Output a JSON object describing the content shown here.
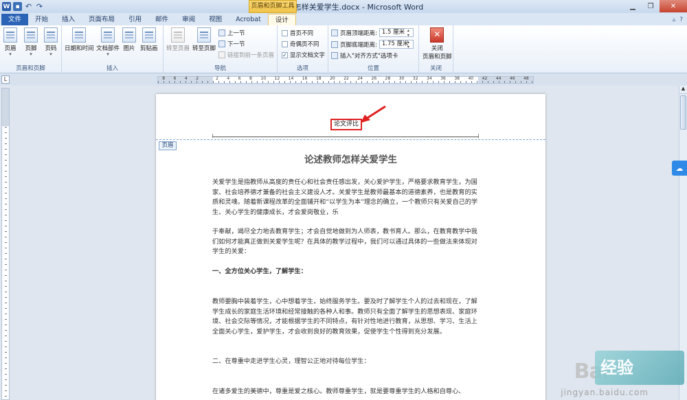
{
  "window": {
    "title": "论述教师怎样关爱学生.docx - Microsoft Word",
    "context_tool": "页眉和页脚工具"
  },
  "tabs": [
    "文件",
    "开始",
    "插入",
    "页面布局",
    "引用",
    "邮件",
    "审阅",
    "视图",
    "Acrobat",
    "设计"
  ],
  "ribbon": {
    "group_header_footer": {
      "label": "页眉和页脚",
      "header": "页眉",
      "footer": "页脚",
      "page_number": "页码"
    },
    "group_insert": {
      "label": "插入",
      "datetime": "日期和时间",
      "doc_parts": "文档部件",
      "picture": "图片",
      "clipart": "剪贴画"
    },
    "group_nav": {
      "label": "导航",
      "goto_header": "转至页眉",
      "goto_footer": "转至页脚",
      "prev": "上一节",
      "next": "下一节",
      "link_prev": "链接到前一条页眉"
    },
    "group_options": {
      "label": "选项",
      "diff_first": "首页不同",
      "diff_odd_even": "奇偶页不同",
      "show_text": "显示文档文字"
    },
    "group_position": {
      "label": "位置",
      "header_top_label": "页眉顶端距离:",
      "header_top_value": "1.5 厘米",
      "footer_bottom_label": "页脚底端距离:",
      "footer_bottom_value": "1.75 厘米",
      "insert_tab": "插入\"对齐方式\"选项卡"
    },
    "group_close": {
      "label": "关闭",
      "close_line1": "关闭",
      "close_line2": "页眉和页脚"
    }
  },
  "ruler_numbers": [
    "8",
    "6",
    "4",
    "2",
    "",
    "2",
    "4",
    "6",
    "8",
    "10",
    "12",
    "14",
    "16",
    "18",
    "20",
    "22",
    "24",
    "26",
    "28",
    "30",
    "32",
    "34",
    "36",
    "38",
    "40",
    "42",
    "44",
    "46",
    "48"
  ],
  "document": {
    "header_text": "论文评比",
    "header_tag": "页眉",
    "title": "论述教师怎样关爱学生",
    "paragraphs": [
      "关爱学生是指教师从高度的责任心和社会责任感出发，关心爱护学生，严格要求教育学生，为国家、社会培养德才兼备的社会主义建设人才。关爱学生是教师最基本的道德素养，也是教育的实质和灵魂。随着新课程改革的全面铺开和“以学生为本”理念的确立，一个教师只有关爱自己的学生、关心学生的健康成长，才会爱岗敬业，乐",
      "于奉献，竭尽全力地去教育学生；才会自觉地做到为人师表，教书育人。那么，在教育教学中我们如何才能真正做到关爱学生呢？在具体的教学过程中，我们可以通过具体的一些做法来体现对学生的关爱：",
      "一、全方位关心学生，了解学生：",
      "教师要胸中装着学生，心中想着学生，始终服务学生。要及时了解学生个人的过去和现在，了解学生成长的家庭生活环境和经常接触的各种人和事。教师只有全面了解学生的思想表现、家庭环境、社会交际等情况，才能根据学生的不同特点，有针对性地进行教育，从思想、学习、生活上全面关心学生，爱护学生，才会收到良好的教育效果，促使学生个性得到充分发展。",
      "二、在尊重中走进学生心灵，理智公正地对待每位学生：",
      "在诸多爱生的美德中，尊重是爱之核心。教师尊重学生，就是要尊重学生的人格和自尊心、"
    ]
  },
  "watermark": {
    "logo": "Bai",
    "logo2": "经验",
    "url": "jingyan.baidu.com"
  }
}
